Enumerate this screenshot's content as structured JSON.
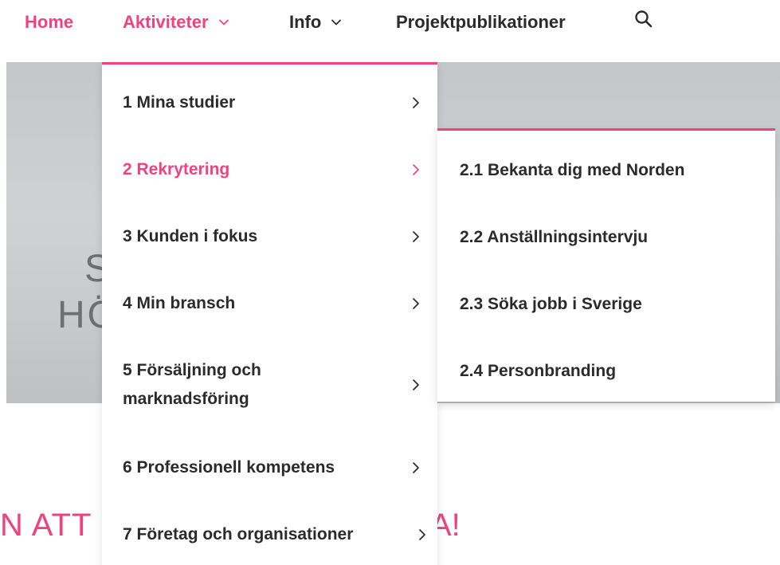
{
  "nav": {
    "home": "Home",
    "aktiviteter": "Aktiviteter",
    "info": "Info",
    "projektpublikationer": "Projektpublikationer",
    "search_icon": "search-icon"
  },
  "hero": {
    "line1": "S",
    "line2": "HÖ"
  },
  "bottom": {
    "left": "N ATT",
    "right": "A!"
  },
  "dropdown": {
    "items": [
      {
        "label": "1 Mina studier"
      },
      {
        "label": "2 Rekrytering"
      },
      {
        "label": "3 Kunden i fokus"
      },
      {
        "label": "4 Min bransch"
      },
      {
        "label": "5 Försäljning och marknadsföring"
      },
      {
        "label": "6 Professionell kompetens"
      },
      {
        "label": "7 Företag och organisationer"
      }
    ]
  },
  "submenu": {
    "items": [
      {
        "label": "2.1 Bekanta dig med Norden"
      },
      {
        "label": "2.2 Anställningsintervju"
      },
      {
        "label": "2.3 Söka jobb i Sverige"
      },
      {
        "label": "2.4 Personbranding"
      }
    ]
  },
  "colors": {
    "accent": "#f0427f",
    "text": "#2b2b2b"
  }
}
